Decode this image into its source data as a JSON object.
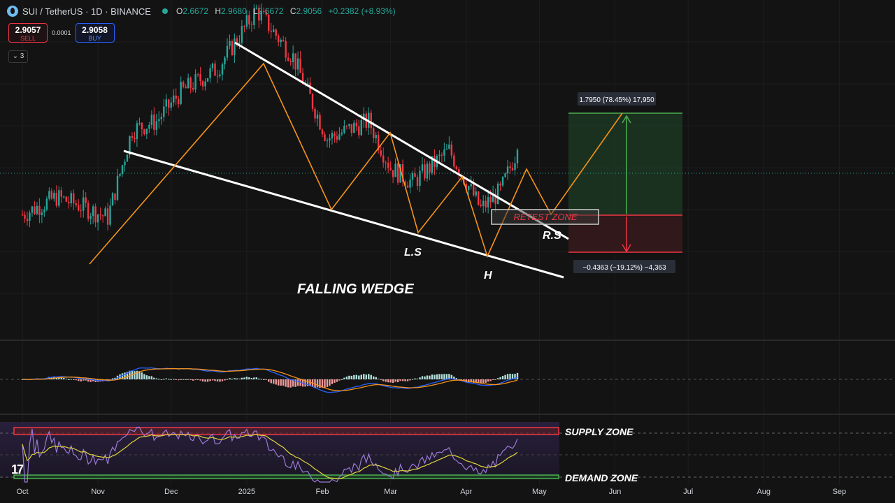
{
  "header": {
    "symbol": "SUI / TetherUS · 1D · BINANCE",
    "open_label": "O",
    "open": "2.6672",
    "high_label": "H",
    "high": "2.9680",
    "low_label": "L",
    "low": "2.6672",
    "close_label": "C",
    "close": "2.9056",
    "change": "+0.2382 (+8.93%)"
  },
  "trade_panel": {
    "sell_price": "2.9057",
    "sell_label": "SELL",
    "spread": "0.0001",
    "buy_price": "2.9058",
    "buy_label": "BUY"
  },
  "indicator_toggle": "3",
  "colors": {
    "up": "#26a69a",
    "down": "#f23645",
    "orange": "#f7931a",
    "macd": "#2962ff",
    "rsi": "#9c7ad6"
  },
  "chart_data": {
    "type": "candlestick",
    "series": [
      {
        "name": "SUI/USDT",
        "role": "price",
        "points": [
          {
            "date": "2024-10-01",
            "close": 1.8
          },
          {
            "date": "2024-10-15",
            "close": 2.1
          },
          {
            "date": "2024-10-25",
            "close": 1.95
          },
          {
            "date": "2024-11-05",
            "close": 1.75
          },
          {
            "date": "2024-11-15",
            "close": 3.25
          },
          {
            "date": "2024-11-25",
            "close": 3.4
          },
          {
            "date": "2024-12-05",
            "close": 3.9
          },
          {
            "date": "2024-12-20",
            "close": 4.3
          },
          {
            "date": "2025-01-05",
            "close": 5.3
          },
          {
            "date": "2025-01-20",
            "close": 4.5
          },
          {
            "date": "2025-02-03",
            "close": 3.1
          },
          {
            "date": "2025-02-20",
            "close": 3.4
          },
          {
            "date": "2025-03-01",
            "close": 2.6
          },
          {
            "date": "2025-03-10",
            "close": 2.35
          },
          {
            "date": "2025-03-25",
            "close": 2.9
          },
          {
            "date": "2025-04-07",
            "close": 1.9
          },
          {
            "date": "2025-04-15",
            "close": 2.2
          },
          {
            "date": "2025-04-22",
            "close": 2.91
          }
        ]
      }
    ],
    "x_ticks": [
      "Oct",
      "Nov",
      "Dec",
      "2025",
      "Feb",
      "Mar",
      "Apr",
      "May",
      "Jun",
      "Jul",
      "Aug",
      "Sep"
    ],
    "annotations": {
      "pattern": "FALLING WEDGE",
      "left_shoulder": "L.S",
      "head": "H",
      "right_shoulder": "R.S",
      "retest_zone": "RETEST ZONE",
      "supply_zone": "SUPPLY ZONE",
      "demand_zone": "DEMAND ZONE",
      "target_label": "1.7950 (78.45%) 17,950",
      "stop_label": "−0.4363 (−19.12%) −4,363"
    },
    "position": {
      "entry": 2.29,
      "target": 4.08,
      "stop": 1.85
    }
  }
}
